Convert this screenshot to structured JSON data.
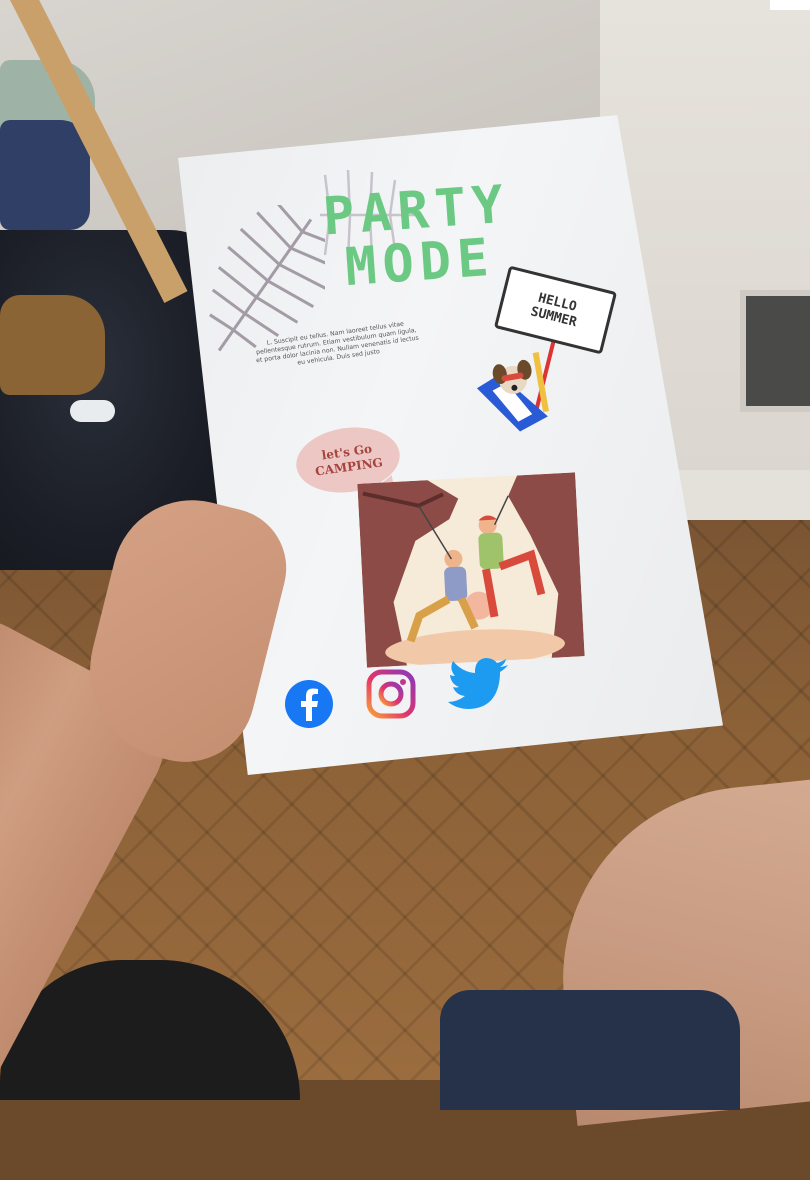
{
  "flyer": {
    "title_line1": "PARTY",
    "title_line2": "MODE",
    "sign_text_line1": "HELLO",
    "sign_text_line2": "SUMMER",
    "body_text": "L. Suscipit eu tellus. Nam laoreet tellus vitae pellentesque rutrum. Etiam vestibulum quam ligula, et porta dolor lacinia non. Nullam venenatis id lectus eu vehicula. Duis sed justo",
    "bubble_text_line1": "let's Go",
    "bubble_text_line2": "CAMPING",
    "colors": {
      "title_green": "#6cc983",
      "bubble_pink": "#ecc7c4",
      "bubble_text": "#a5433f",
      "facebook_blue": "#1877f2",
      "twitter_blue": "#1d9bf0"
    },
    "icons": [
      "facebook-icon",
      "instagram-icon",
      "twitter-icon"
    ]
  }
}
